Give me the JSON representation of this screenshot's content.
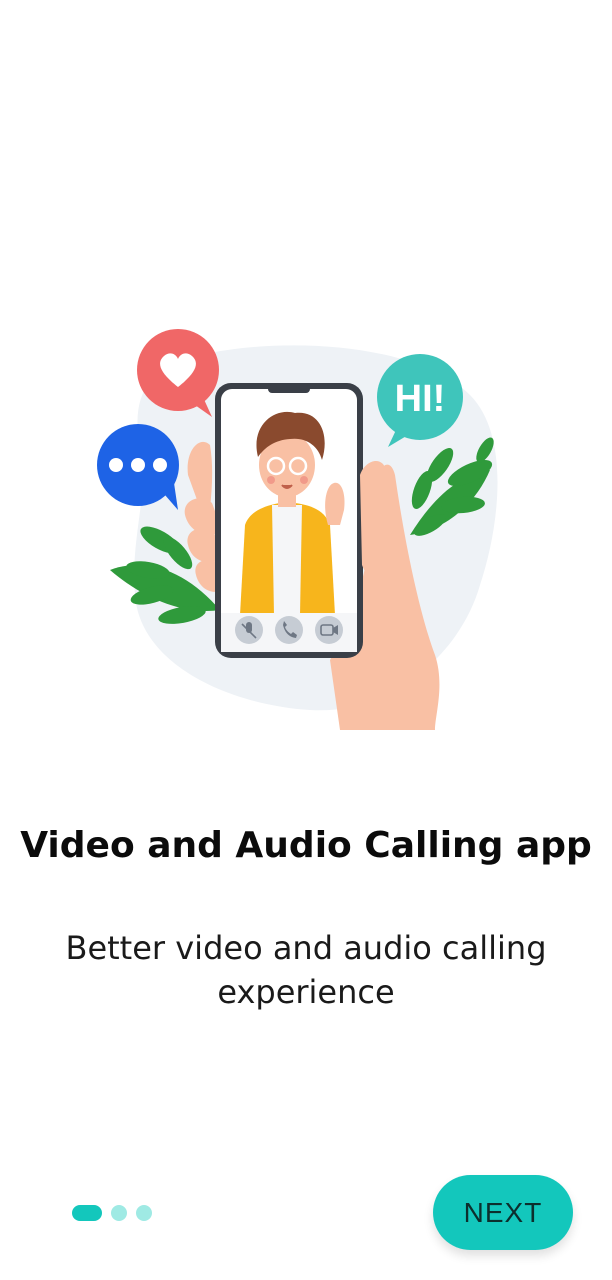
{
  "onboarding": {
    "title": "Video and Audio Calling app",
    "subtitle": "Better video and audio calling experience",
    "pagination": {
      "total": 3,
      "current": 1
    },
    "next_label": "NEXT",
    "bubble_hi_text": "HI!"
  },
  "colors": {
    "accent": "#13c7bc",
    "accent_light": "#9feae4",
    "bubble_red": "#f06767",
    "bubble_blue": "#1e63e6",
    "bubble_teal": "#3fc5bb",
    "leaf_green": "#2f9a3b",
    "jacket_yellow": "#f7b51c",
    "skin": "#f9c0a4"
  },
  "icons": [
    "heart-icon",
    "chat-dots-icon",
    "mute-mic-icon",
    "phone-icon",
    "video-camera-icon"
  ]
}
